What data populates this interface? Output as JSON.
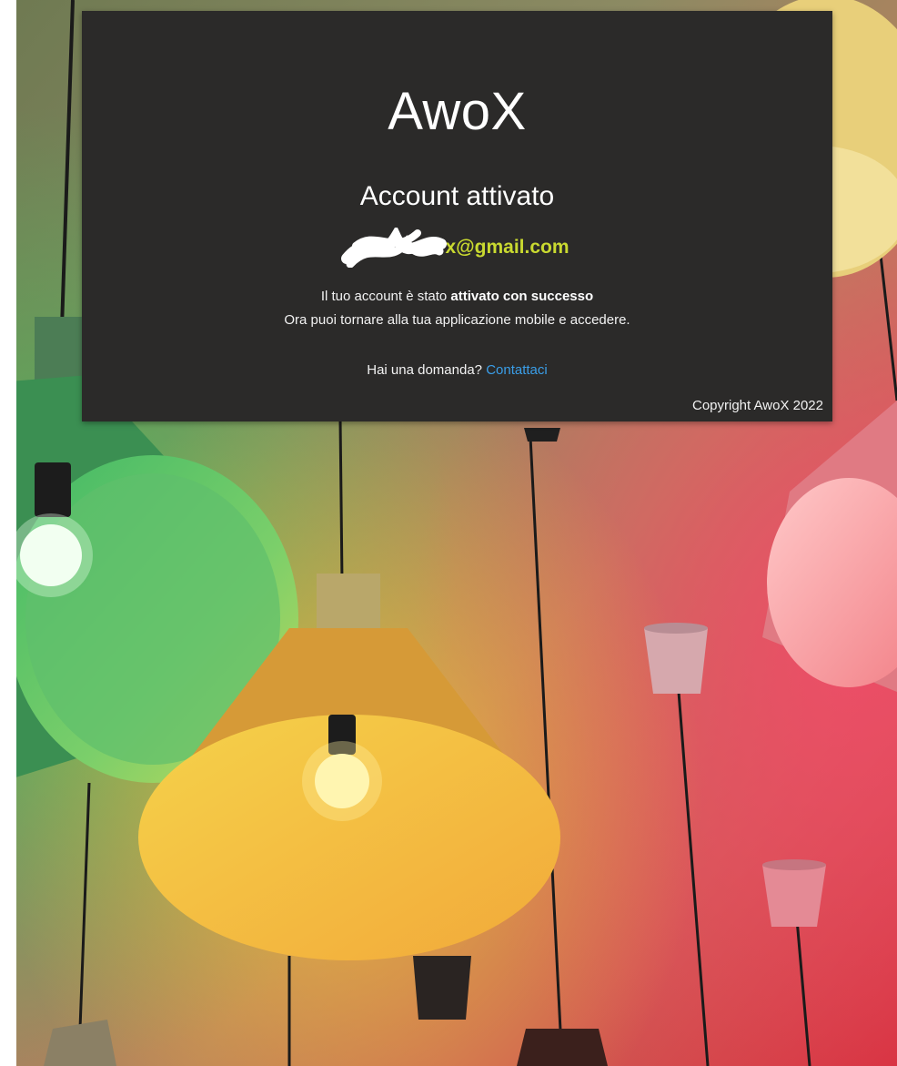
{
  "brand": {
    "name": "AwoX"
  },
  "status": {
    "title": "Account attivato",
    "email": "x@gmail.com"
  },
  "message": {
    "line1_prefix": "Il tuo account è stato",
    "line1_bold": "attivato con successo",
    "line2": "Ora puoi tornare alla tua applicazione mobile e accedere."
  },
  "contact": {
    "question": "Hai una domanda?",
    "link_label": "Contattaci"
  },
  "footer": {
    "copyright": "Copyright AwoX 2022"
  },
  "colors": {
    "card_background": "#2b2a29",
    "email_accent": "#c9d930",
    "link": "#3a9ee8"
  }
}
